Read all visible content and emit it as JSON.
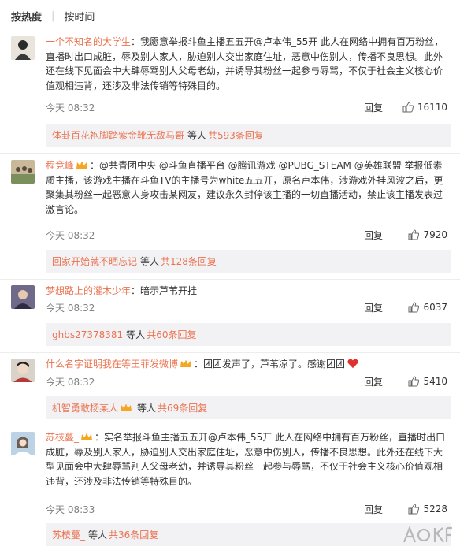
{
  "sort": {
    "hot_label": "按热度",
    "time_label": "按时间"
  },
  "comments": [
    {
      "user": "一个不知名的大学生",
      "text": "：我愿意举报斗鱼主播五五开@卢本伟_55开 此人在网络中拥有百万粉丝，直播时出口成脏，辱及别人家人，胁迫别人交出家庭住址，恶意中伤别人，传播不良思想。此外还在线下见面会中大肆辱骂别人父母老幼，并诱导其粉丝一起参与辱骂，不仅于社会主义核心价值观相违背，还涉及非法传销等特殊目的。",
      "time": "今天 08:32",
      "reply": "回复",
      "likes": "16110",
      "sub_user": "体卦百花袍脚踏紫金靴无敌马哥",
      "sub_etc": "等人",
      "sub_more": "共593条回复"
    },
    {
      "user": "程竞峰",
      "text": "：@共青团中央 @斗鱼直播平台 @腾讯游戏 @PUBG_STEAM @英雄联盟 举报低素质主播，该游戏主播在斗鱼TV的主播号为white五五开，原名卢本伟，涉游戏外挂风波之后，更聚集其粉丝一起恶意人身攻击某网友，建议永久封停该主播的一切直播活动，禁止该主播发表过激言论。",
      "time": "今天 08:32",
      "reply": "回复",
      "likes": "7920",
      "sub_user": "回家开始就不晒忘记",
      "sub_etc": "等人",
      "sub_more": "共128条回复"
    },
    {
      "user": "梦想路上的灌木少年",
      "text": "：暗示芦苇开挂",
      "time": "今天 08:32",
      "reply": "回复",
      "likes": "6037",
      "sub_user": "ghbs27378381",
      "sub_etc": "等人",
      "sub_more": "共60条回复"
    },
    {
      "user": "什么名字证明我在等王菲发微博",
      "text": "：团团发声了，芦苇凉了。感谢团团",
      "time": "今天 08:32",
      "reply": "回复",
      "likes": "5410",
      "sub_user": "机智勇敢杨某人",
      "sub_etc": "等人",
      "sub_more": "共69条回复"
    },
    {
      "user": "苏枝蔓_",
      "text": "：实名举报斗鱼主播五五开@卢本伟_55开 此人在网络中拥有百万粉丝，直播时出口成脏，辱及别人家人，胁迫别人交出家庭住址，恶意中伤别人，传播不良思想。此外还在线下大型见面会中大肆辱骂别人父母老幼，并诱导其粉丝一起参与辱骂，不仅于社会主义核心价值观相违背，还涉及非法传销等特殊目的。",
      "time": "今天 08:33",
      "reply": "回复",
      "likes": "5228",
      "sub_user": "苏枝蔓_",
      "sub_etc": "等人",
      "sub_more": "共36条回复"
    }
  ],
  "colors": {
    "accent": "#eb7350",
    "subbox_bg": "#f2f2f5",
    "text": "#333333",
    "muted": "#808080"
  },
  "icons": {
    "like": "thumbs-up-icon",
    "vip": "vip-crown-icon",
    "heart": "heart-emoji-icon"
  }
}
